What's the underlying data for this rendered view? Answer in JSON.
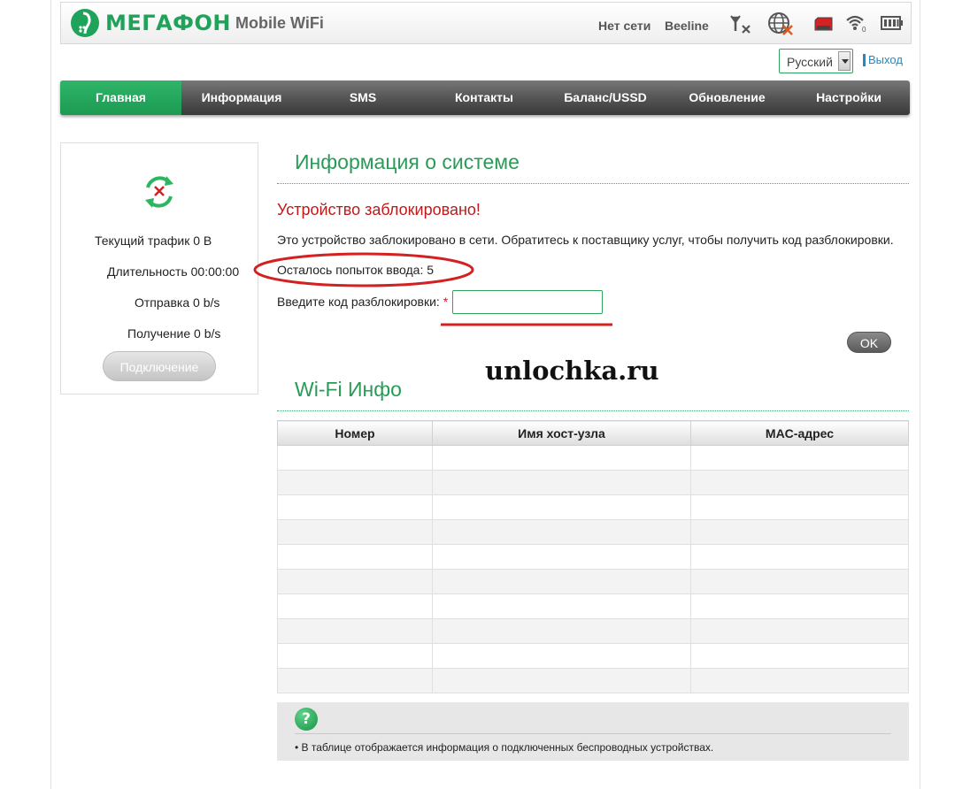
{
  "header": {
    "brand": "МЕГАФОН",
    "product": "Mobile WiFi",
    "network_status": "Нет сети",
    "operator": "Beeline",
    "icons": [
      "no-signal-icon",
      "globe-disconnected-icon",
      "sim-icon",
      "wifi-icon",
      "battery-icon"
    ],
    "wifi_clients": "0",
    "brand_color": "#1fa35a"
  },
  "language": {
    "selected": "Русский",
    "logout": "Выход"
  },
  "nav": {
    "tabs": [
      {
        "label": "Главная",
        "active": true
      },
      {
        "label": "Информация"
      },
      {
        "label": "SMS"
      },
      {
        "label": "Контакты"
      },
      {
        "label": "Баланс/USSD"
      },
      {
        "label": "Обновление"
      },
      {
        "label": "Настройки"
      }
    ]
  },
  "left_panel": {
    "traffic_label": "Текущий трафик",
    "traffic_value": "0 B",
    "duration_label": "Длительность",
    "duration_value": "00:00:00",
    "upload_label": "Отправка",
    "upload_value": "0 b/s",
    "download_label": "Получение",
    "download_value": "0 b/s",
    "connect_button": "Подключение"
  },
  "system_info": {
    "title": "Информация о системе",
    "locked_heading": "Устройство заблокировано!",
    "message": "Это устройство заблокировано в сети. Обратитесь к поставщику услуг, чтобы получить код разблокировки.",
    "attempts_label": "Осталось попыток ввода:",
    "attempts_value": "5",
    "code_label": "Введите код разблокировки:",
    "required_mark": "*",
    "code_value": "",
    "ok_button": "OK"
  },
  "watermark": "unlochka.ru",
  "wifi_info": {
    "title": "Wi-Fi Инфо",
    "columns": [
      "Номер",
      "Имя хост-узла",
      "MAC-адрес"
    ]
  },
  "help": {
    "text": "• В таблице отображается информация о подключенных беспроводных устройствах."
  },
  "colors": {
    "accent": "#2a9b57",
    "alert": "#bb1b1b",
    "annotation": "#d42020"
  }
}
